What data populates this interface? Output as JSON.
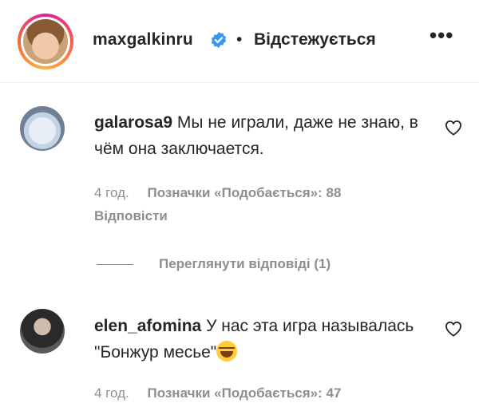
{
  "post_header": {
    "username": "maxgalkinru",
    "separator": "•",
    "follow_status": "Відстежується",
    "more_label": "•••"
  },
  "comments": [
    {
      "username": "galarosa9",
      "text": "Мы не играли, даже не знаю, в чём она заключается.",
      "time": "4 год.",
      "likes": "Позначки «Подобається»: 88",
      "reply_label": "Відповісти",
      "view_replies": "Переглянути відповіді (1)"
    },
    {
      "username": "elen_afomina",
      "text": "У нас эта игра называлась \"Бонжур месье\"",
      "time": "4 год.",
      "likes": "Позначки «Подобається»: 47"
    }
  ],
  "colors": {
    "text": "#262626",
    "muted": "#8e8e8e",
    "verified": "#3897f0"
  },
  "icons": {
    "verified": "verified-badge-icon",
    "heart": "heart-outline-icon",
    "more": "more-dots-icon",
    "emoji": "laughing-tears-emoji"
  }
}
